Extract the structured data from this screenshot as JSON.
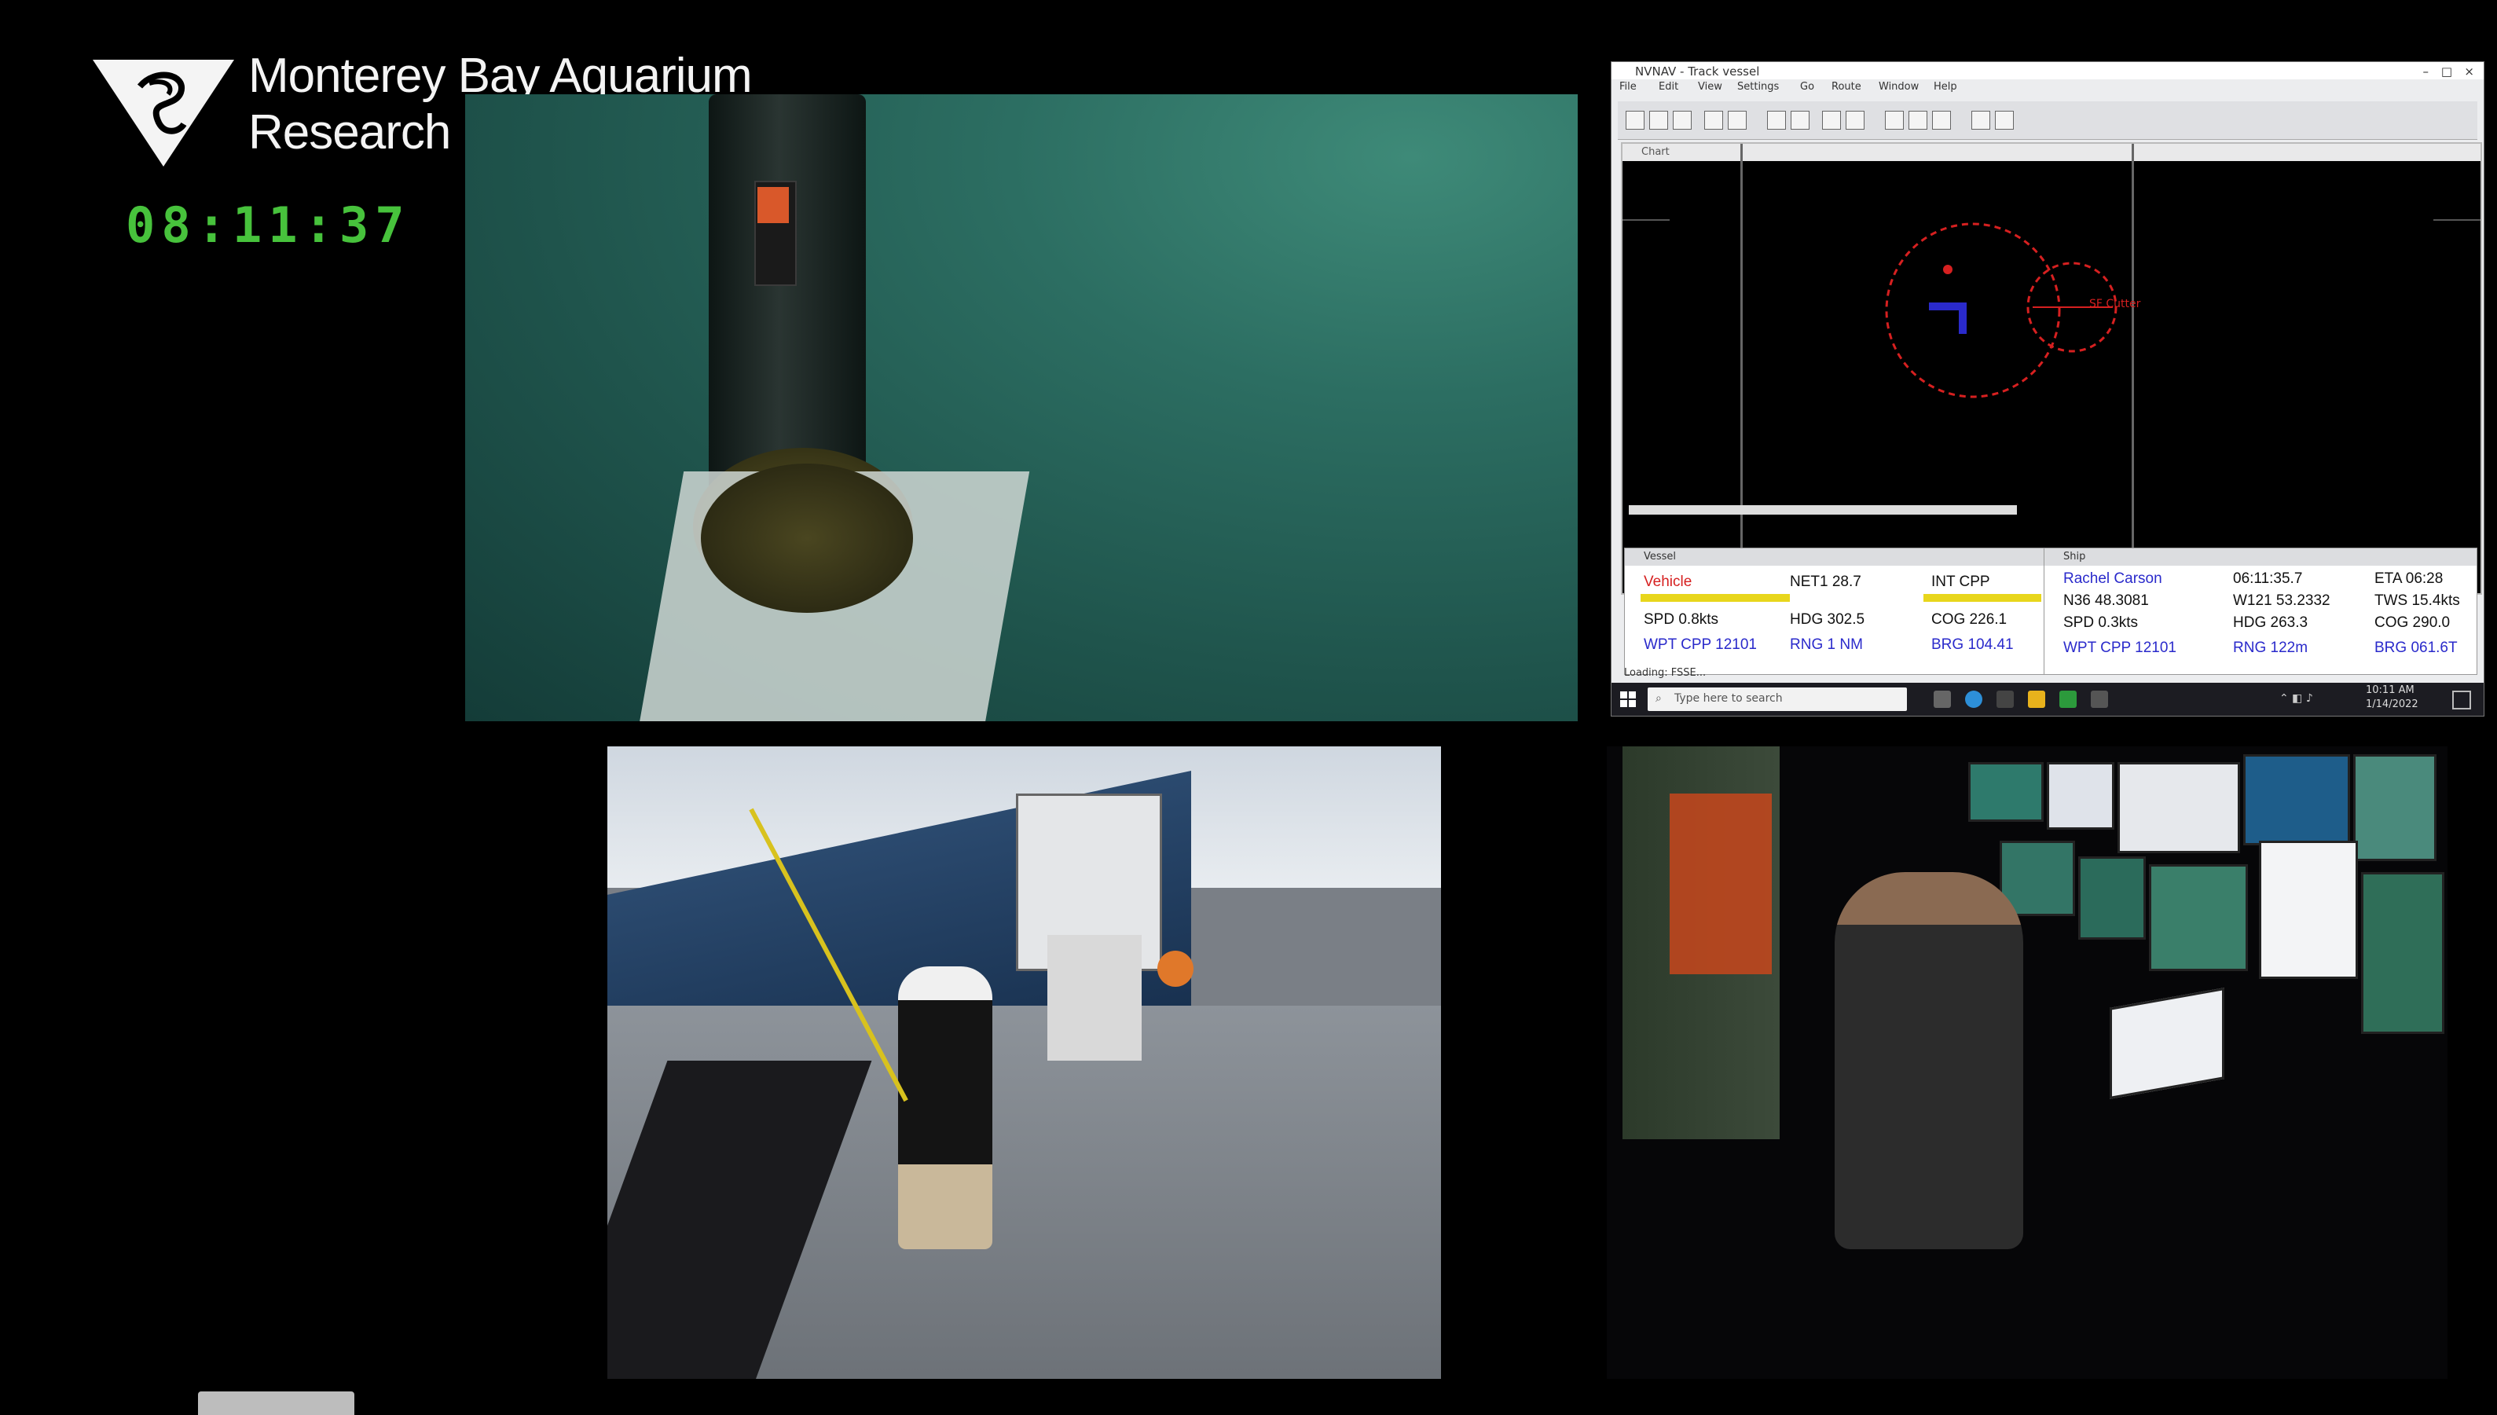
{
  "branding": {
    "org_line1": "Monterey Bay Aquarium",
    "org_line2": "Research Institute",
    "logo_icon": "mbari-triangle-logo"
  },
  "clock": "08:11:37",
  "panels": {
    "underwater_camera": "underwater-camera-feed",
    "deck_camera": "ship-deck-camera-feed",
    "control_room_camera": "control-room-camera-feed"
  },
  "navigation_window": {
    "title": "NVNAV - Track vessel",
    "menu": [
      "File",
      "Edit",
      "View",
      "Settings",
      "Go",
      "Route",
      "Window",
      "Help"
    ],
    "chart_title": "Chart",
    "target_label": "SF Cutter",
    "vessel_panel": {
      "title": "Vessel",
      "r1": [
        "Vehicle",
        "NET1 28.7",
        "INT CPP"
      ],
      "r2": [
        "SPD 0.8kts",
        "HDG 302.5",
        "COG 226.1"
      ],
      "r3": [
        "WPT CPP 12101",
        "RNG 1 NM",
        "BRG 104.41"
      ]
    },
    "ship_panel": {
      "title": "Ship",
      "r1": [
        "Rachel Carson",
        "06:11:35.7",
        "ETA 06:28"
      ],
      "r2": [
        "N36 48.3081",
        "W121 53.2332",
        "TWS 15.4kts"
      ],
      "r3": [
        "SPD 0.3kts",
        "HDG 263.3",
        "COG 290.0"
      ],
      "r4": [
        "WPT CPP 12101",
        "RNG 122m",
        "BRG 061.6T"
      ]
    },
    "status_line": "Loading: FSSE...",
    "taskbar": {
      "search_placeholder": "Type here to search",
      "time": "10:11 AM",
      "date": "1/14/2022"
    }
  },
  "colors": {
    "clock": "#47c23c",
    "range_rings": "#d62020",
    "vessel_marker": "#2a2acb"
  }
}
